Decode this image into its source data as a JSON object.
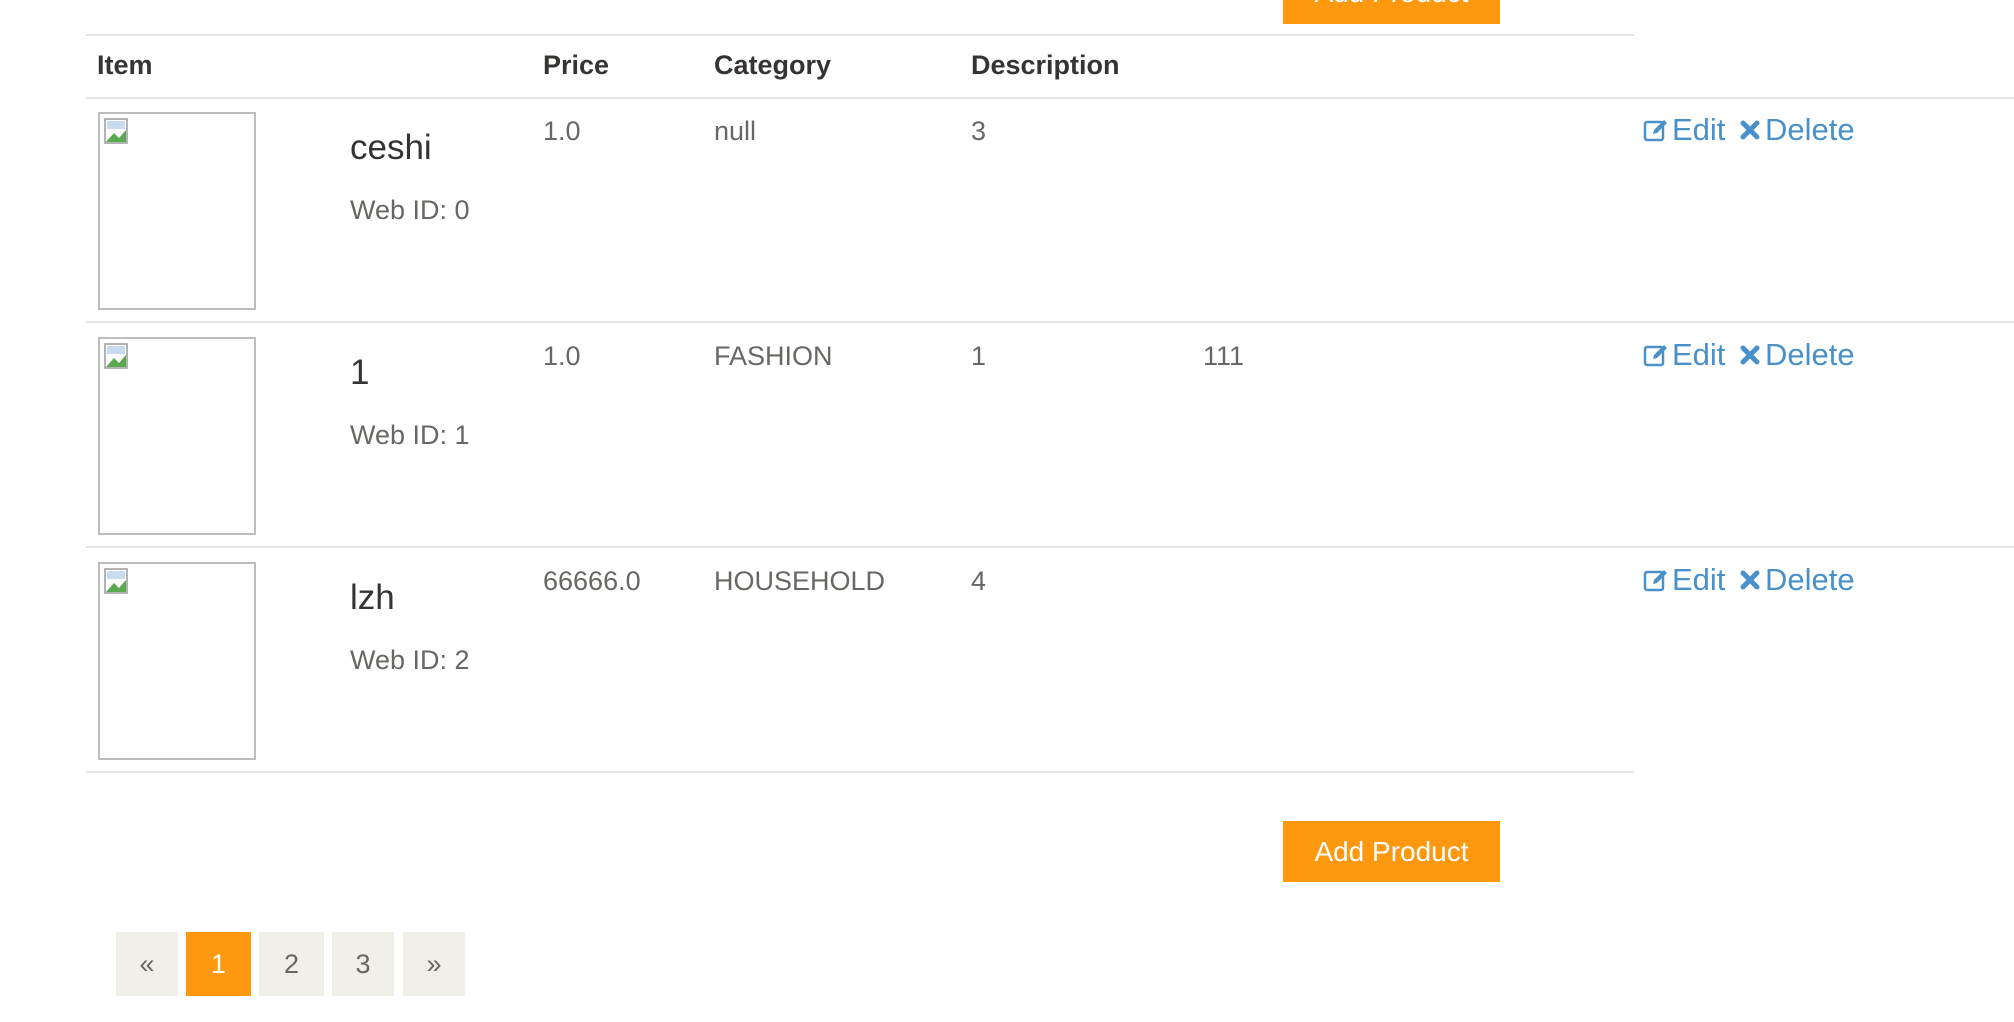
{
  "add_button_label": "Add Product",
  "table": {
    "headers": {
      "item": "Item",
      "price": "Price",
      "category": "Category",
      "description": "Description"
    },
    "rows": [
      {
        "name": "ceshi",
        "web_id": "Web ID: 0",
        "price": "1.0",
        "category": "null",
        "quantity": "3",
        "description": "",
        "edit": "Edit",
        "delete": "Delete"
      },
      {
        "name": "1",
        "web_id": "Web ID: 1",
        "price": "1.0",
        "category": "FASHION",
        "quantity": "1",
        "description": "111",
        "edit": "Edit",
        "delete": "Delete"
      },
      {
        "name": "lzh",
        "web_id": "Web ID: 2",
        "price": "66666.0",
        "category": "HOUSEHOLD",
        "quantity": "4",
        "description": "",
        "edit": "Edit",
        "delete": "Delete"
      }
    ]
  },
  "pagination": {
    "prev": "«",
    "pages": [
      "1",
      "2",
      "3"
    ],
    "next": "»",
    "current": "1"
  },
  "colors": {
    "accent": "#fe980f",
    "link": "#4a90c9"
  }
}
